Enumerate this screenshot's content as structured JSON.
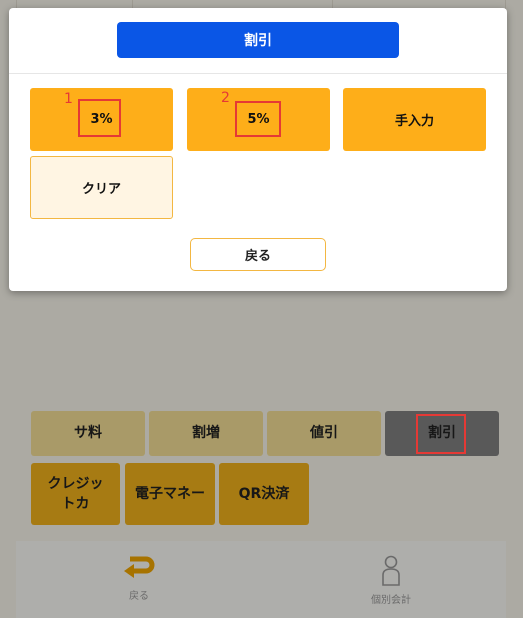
{
  "background": {
    "adjust_buttons": [
      {
        "label": "サ料"
      },
      {
        "label": "割増"
      },
      {
        "label": "値引"
      },
      {
        "label": "割引"
      }
    ],
    "payment_buttons": [
      {
        "label": "クレジットカ"
      },
      {
        "label": "電子マネー"
      },
      {
        "label": "QR決済"
      }
    ],
    "footer": {
      "back_label": "戻る",
      "split_label": "個別会計"
    }
  },
  "modal": {
    "title": "割引",
    "options": [
      {
        "label": "3%"
      },
      {
        "label": "5%"
      },
      {
        "label": "手入力"
      },
      {
        "label": "クリア"
      }
    ],
    "back_label": "戻る"
  },
  "annotations": [
    "1",
    "2"
  ],
  "colors": {
    "accent_blue": "#0a56e6",
    "button_orange": "#feae19",
    "annotation_red": "#e53935"
  }
}
